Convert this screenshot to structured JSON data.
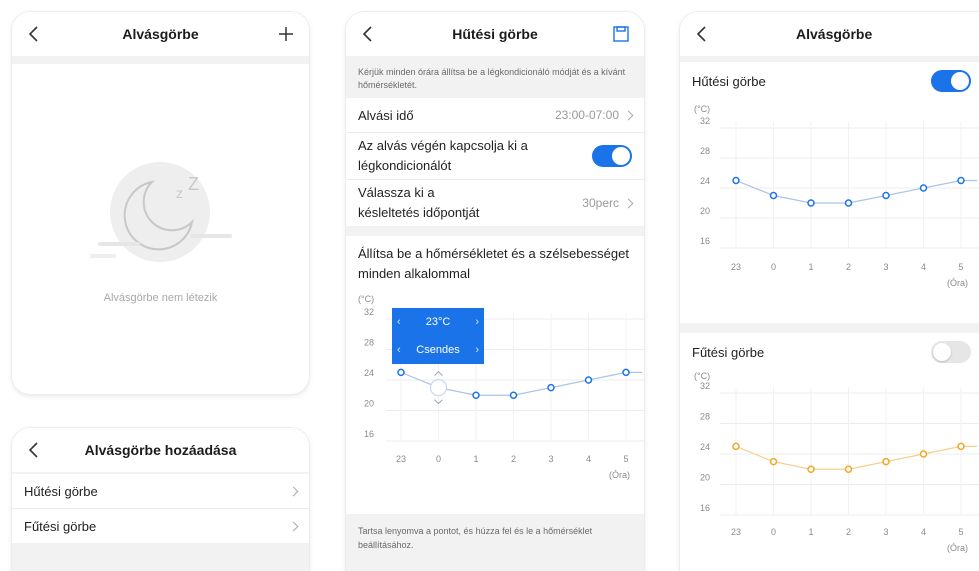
{
  "screen1": {
    "title": "Alvásgörbe",
    "empty_text": "Alvásgörbe nem létezik"
  },
  "screen2": {
    "title": "Alvásgörbe hozáadása",
    "items": [
      "Hűtési görbe",
      "Fűtési görbe"
    ]
  },
  "screen3": {
    "title": "Hűtési görbe",
    "hint": "Kérjük minden órára állítsa be a légkondicionáló módját és a kívánt hőmérsékletét.",
    "sleep_time_label": "Alvási idő",
    "sleep_time_value": "23:00-07:00",
    "turnoff_label": "Az alvás végén kapcsolja ki a légkondicionálót",
    "delay_label": "Válassza ki a késleltetés időpontját",
    "delay_value": "30perc",
    "section_title": "Állítsa be a hőmérsékletet és a szélsebességet minden alkalommal",
    "tooltip_temp": "23°C",
    "tooltip_mode": "Csendes",
    "footer": "Tartsa lenyomva a pontot, és húzza fel és le a hőmérséklet beállításához."
  },
  "screen4": {
    "title": "Alvásgörbe",
    "cooling_label": "Hűtési görbe",
    "heating_label": "Fűtési görbe"
  },
  "chart_data": [
    {
      "type": "line",
      "title": "Hűtési görbe",
      "ylabel": "(°C)",
      "xlabel": "(Óra)",
      "categories": [
        "23",
        "0",
        "1",
        "2",
        "3",
        "4",
        "5"
      ],
      "values": [
        25,
        23,
        22,
        22,
        23,
        24,
        25
      ],
      "yticks": [
        32,
        28,
        24,
        20,
        16
      ],
      "ylim": [
        16,
        32
      ],
      "color": "#1a73e8"
    },
    {
      "type": "line",
      "title": "Hűtési görbe",
      "ylabel": "(°C)",
      "xlabel": "(Óra)",
      "categories": [
        "23",
        "0",
        "1",
        "2",
        "3",
        "4",
        "5"
      ],
      "values": [
        25,
        23,
        22,
        22,
        23,
        24,
        25
      ],
      "yticks": [
        32,
        28,
        24,
        20,
        16
      ],
      "ylim": [
        16,
        32
      ],
      "color": "#1a73e8"
    },
    {
      "type": "line",
      "title": "Fűtési görbe",
      "ylabel": "(°C)",
      "xlabel": "(Óra)",
      "categories": [
        "23",
        "0",
        "1",
        "2",
        "3",
        "4",
        "5"
      ],
      "values": [
        25,
        23,
        22,
        22,
        23,
        24,
        25
      ],
      "yticks": [
        32,
        28,
        24,
        20,
        16
      ],
      "ylim": [
        16,
        32
      ],
      "color": "#f2a623"
    }
  ],
  "colors": {
    "accent": "#1a73e8",
    "heating": "#f2a623"
  }
}
